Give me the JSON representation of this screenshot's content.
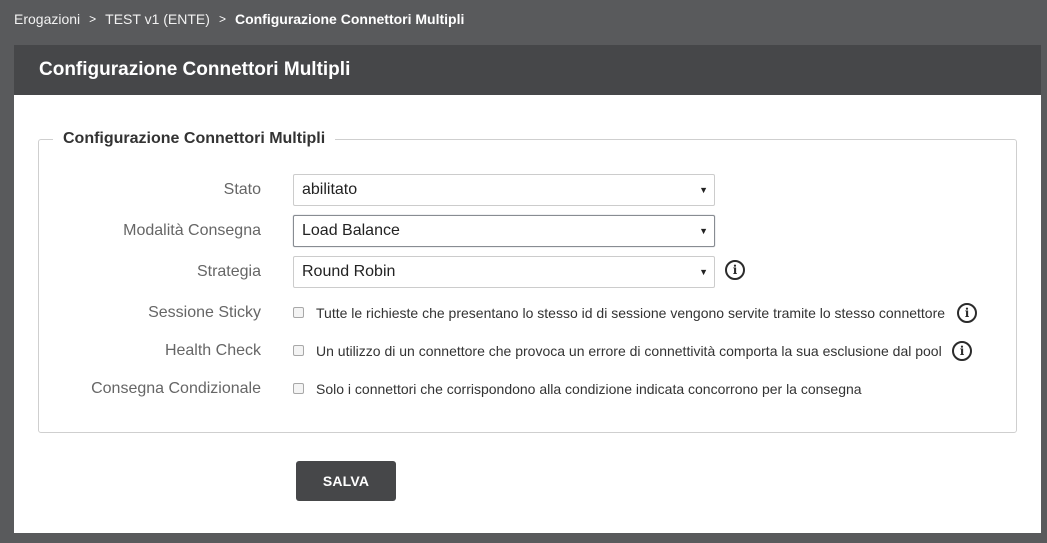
{
  "breadcrumb": {
    "items": [
      "Erogazioni",
      "TEST v1 (ENTE)",
      "Configurazione Connettori Multipli"
    ],
    "separator": ">"
  },
  "panel": {
    "title": "Configurazione Connettori Multipli"
  },
  "form": {
    "legend": "Configurazione Connettori Multipli",
    "stato": {
      "label": "Stato",
      "value": "abilitato"
    },
    "modalita": {
      "label": "Modalità Consegna",
      "value": "Load Balance"
    },
    "strategia": {
      "label": "Strategia",
      "value": "Round Robin"
    },
    "sessione_sticky": {
      "label": "Sessione Sticky",
      "checked": false,
      "text": "Tutte le richieste che presentano lo stesso id di sessione vengono servite tramite lo stesso connettore"
    },
    "health_check": {
      "label": "Health Check",
      "checked": false,
      "text": "Un utilizzo di un connettore che provoca un errore di connettività comporta la sua esclusione dal pool"
    },
    "consegna_condizionale": {
      "label": "Consegna Condizionale",
      "checked": false,
      "text": "Solo i connettori che corrispondono alla condizione indicata concorrono per la consegna"
    }
  },
  "actions": {
    "save_label": "SALVA"
  },
  "icons": {
    "caret": "▼",
    "info": "i"
  },
  "colors": {
    "page_bg": "#595a5c",
    "header_bg": "#464749",
    "button_bg": "#464749"
  }
}
